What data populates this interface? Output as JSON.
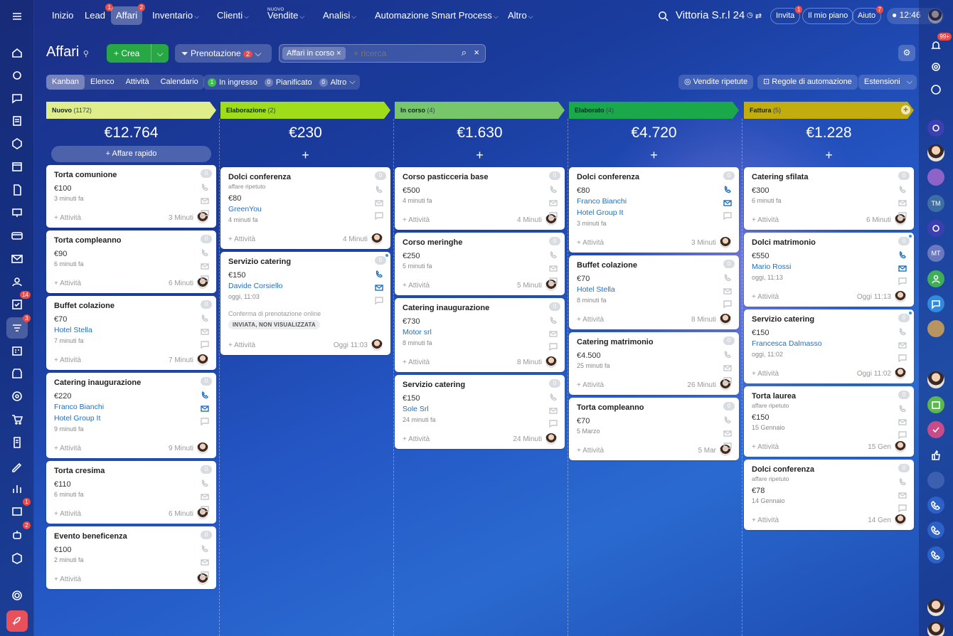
{
  "nav": {
    "items": [
      {
        "label": "Inizio",
        "x": 0
      },
      {
        "label": "Lead",
        "badge": "1"
      },
      {
        "label": "Affari",
        "badge": "2",
        "active": true
      },
      {
        "label": "Inventario"
      },
      {
        "label": "Clienti"
      },
      {
        "label": "Vendite",
        "super": "NUOVO"
      },
      {
        "label": "Analisi"
      },
      {
        "label": "Automazione Smart Process"
      },
      {
        "label": "Altro"
      }
    ],
    "company": "Vittoria S.r.l 24",
    "invite": "Invita",
    "invite_badge": "1",
    "plan": "Il mio piano",
    "help": "Aiuto",
    "help_badge": "7",
    "clock": "12:46"
  },
  "leftbar": {
    "badge_tasks": "14",
    "badge_crm": "3",
    "badge_chat": "1",
    "badge_bot": "2"
  },
  "rightbar": {
    "notif_badge": "99+",
    "avatar_tm": "TM",
    "avatar_mt": "MT"
  },
  "page": {
    "title": "Affari"
  },
  "toolbar": {
    "create": "Crea",
    "pipeline": "Prenotazione",
    "pipeline_badge": "2",
    "filter_chip": "Affari in corso",
    "search_placeholder": "+ ricerca"
  },
  "views": [
    "Kanban",
    "Elenco",
    "Attività",
    "Calendario"
  ],
  "counters": [
    {
      "num": "1",
      "label": "In ingresso"
    },
    {
      "num": "0",
      "label": "Pianificato"
    },
    {
      "num": "0",
      "label": "Altro"
    }
  ],
  "right_buttons": {
    "repeat": "Vendite ripetute",
    "rules": "Regole di automazione",
    "ext": "Estensioni"
  },
  "columns": [
    {
      "name": "Nuovo",
      "count": "(1172)",
      "color": "#dfee8a",
      "total": "€12.764",
      "quick": "Affare rapido",
      "cards": [
        {
          "title": "Torta comunione",
          "price": "€100",
          "time": "3 minuti fa",
          "foot": "3 Minuti"
        },
        {
          "title": "Torta compleanno",
          "price": "€90",
          "time": "6 minuti fa",
          "foot": "6 Minuti"
        },
        {
          "title": "Buffet colazione",
          "price": "€70",
          "links": [
            "Hotel Stella"
          ],
          "time": "7 minuti fa",
          "foot": "7 Minuti"
        },
        {
          "title": "Catering inaugurazione",
          "price": "€220",
          "links": [
            "Franco Bianchi",
            "Hotel Group It"
          ],
          "time": "9 minuti fa",
          "foot": "9 Minuti",
          "on": true
        },
        {
          "title": "Torta cresima",
          "price": "€110",
          "time": "6 minuti fa",
          "foot": "6 Minuti"
        },
        {
          "title": "Evento beneficenza",
          "price": "€100",
          "time": "2 minuti fa",
          "foot": ""
        }
      ]
    },
    {
      "name": "Elaborazione",
      "count": "(2)",
      "color": "#9fdc1a",
      "total": "€230",
      "cards": [
        {
          "title": "Dolci conferenza",
          "sub": "affare ripetuto",
          "price": "€80",
          "links": [
            "GreenYou"
          ],
          "time": "4 minuti fa",
          "foot": "4 Minuti"
        },
        {
          "title": "Servizio catering",
          "price": "€150",
          "links": [
            "Davide Corsiello"
          ],
          "time": "oggi, 11:03",
          "note": "Conferma di prenotazione online",
          "tag": "INVIATA, NON VISUALIZZATA",
          "foot": "Oggi 11:03",
          "dot": true,
          "on": true
        }
      ]
    },
    {
      "name": "In corso",
      "count": "(4)",
      "color": "#77c76a",
      "total": "€1.630",
      "cards": [
        {
          "title": "Corso pasticceria base",
          "price": "€500",
          "time": "4 minuti fa",
          "foot": "4 Minuti"
        },
        {
          "title": "Corso meringhe",
          "price": "€250",
          "time": "5 minuti fa",
          "foot": "5 Minuti"
        },
        {
          "title": "Catering inaugurazione",
          "price": "€730",
          "links": [
            "Motor srl"
          ],
          "time": "8 minuti fa",
          "foot": "8 Minuti"
        },
        {
          "title": "Servizio catering",
          "price": "€150",
          "links": [
            "Sole Srl"
          ],
          "time": "24 minuti fa",
          "foot": "24 Minuti"
        }
      ]
    },
    {
      "name": "Elaborato",
      "count": "(4)",
      "color": "#1aa84a",
      "total": "€4.720",
      "cards": [
        {
          "title": "Dolci conferenza",
          "price": "€80",
          "links": [
            "Franco Bianchi",
            "Hotel Group It"
          ],
          "time": "3 minuti fa",
          "foot": "3 Minuti",
          "on": true
        },
        {
          "title": "Buffet colazione",
          "price": "€70",
          "links": [
            "Hotel Stella"
          ],
          "time": "8 minuti fa",
          "foot": "8 Minuti"
        },
        {
          "title": "Catering matrimonio",
          "price": "€4.500",
          "time": "25 minuti fa",
          "foot": "26 Minuti"
        },
        {
          "title": "Torta compleanno",
          "price": "€70",
          "time": "5 Marzo",
          "foot": "5 Mar"
        }
      ]
    },
    {
      "name": "Fattura",
      "count": "(5)",
      "color": "#c2ac0e",
      "total": "€1.228",
      "cards": [
        {
          "title": "Catering sfilata",
          "price": "€300",
          "time": "6 minuti fa",
          "foot": "6 Minuti"
        },
        {
          "title": "Dolci matrimonio",
          "price": "€550",
          "links": [
            "Mario Rossi"
          ],
          "time": "oggi, 11:13",
          "foot": "Oggi 11:13",
          "dot": true,
          "on": true
        },
        {
          "title": "Servizio catering",
          "price": "€150",
          "links": [
            "Francesca Dalmasso"
          ],
          "time": "oggi, 11:02",
          "foot": "Oggi 11:02",
          "dot": true
        },
        {
          "title": "Torta laurea",
          "sub": "affare ripetuto",
          "price": "€150",
          "time": "15 Gennaio",
          "foot": "15 Gen"
        },
        {
          "title": "Dolci conferenza",
          "sub": "affare ripetuto",
          "price": "€78",
          "time": "14 Gennaio",
          "foot": "14 Gen"
        }
      ]
    }
  ],
  "card_common": {
    "badge": "0",
    "activity": "+ Attività"
  }
}
